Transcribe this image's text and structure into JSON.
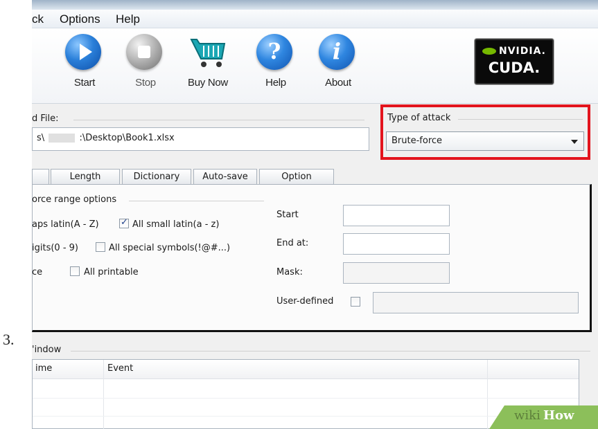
{
  "menu": {
    "items": [
      "ck",
      "Options",
      "Help"
    ]
  },
  "toolbar": {
    "start_label": "Start",
    "stop_label": "Stop",
    "buy_label": "Buy Now",
    "help_label": "Help",
    "about_label": "About",
    "help_glyph": "?",
    "about_glyph": "i"
  },
  "nvidia": {
    "line1": "NVIDIA.",
    "line2": "CUDA."
  },
  "file": {
    "label": "d File:",
    "path_prefix": "s\\",
    "path_suffix": ":\\Desktop\\Book1.xlsx"
  },
  "attack": {
    "label": "Type of attack",
    "value": "Brute-force",
    "highlight_color": "#e3141d"
  },
  "tabs": [
    "Length",
    "Dictionary",
    "Auto-save",
    "Option"
  ],
  "range": {
    "title": "orce range options",
    "caps": {
      "label": "aps latin(A - Z)"
    },
    "small": {
      "label": "All small latin(a - z)",
      "checked": true
    },
    "digits": {
      "label": "igits(0 - 9)"
    },
    "special": {
      "label": "All special symbols(!@#...)",
      "checked": false
    },
    "space": {
      "label": "ce"
    },
    "printable": {
      "label": "All printable",
      "checked": false
    }
  },
  "fields": {
    "start_label": "Start",
    "end_label": "End at:",
    "mask_label": "Mask:",
    "user_label": "User-defined"
  },
  "step_number": "3.",
  "log": {
    "title": "'indow",
    "columns": [
      "ime",
      "Event"
    ]
  },
  "watermark": {
    "wiki": "wiki",
    "how": "How"
  }
}
